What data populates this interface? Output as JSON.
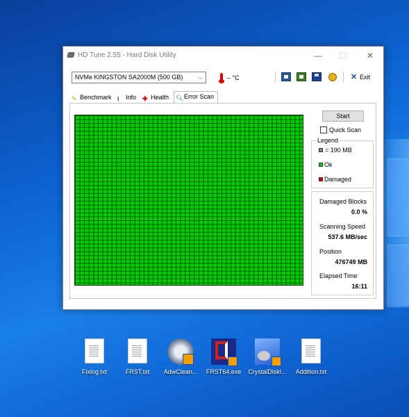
{
  "window": {
    "title": "HD Tune 2.55 - Hard Disk Utility",
    "minimize": "—",
    "maximize": "☐",
    "close": "✕"
  },
  "toolbar": {
    "drive": "NVMe    KINGSTON SA2000M (500 GB)",
    "temperature": "– °C",
    "exit_label": "Exit",
    "icons": [
      "copy-info-icon",
      "copy-screenshot-icon",
      "save-icon",
      "options-icon",
      "exit-icon"
    ]
  },
  "tabs": [
    {
      "label": "Benchmark",
      "icon": "benchmark-icon"
    },
    {
      "label": "Info",
      "icon": "info-icon"
    },
    {
      "label": "Health",
      "icon": "health-icon"
    },
    {
      "label": "Error Scan",
      "icon": "magnifier-icon",
      "active": true
    }
  ],
  "error_scan": {
    "start_label": "Start",
    "quick_scan_label": "Quick Scan",
    "quick_scan_checked": false,
    "legend": {
      "title": "Legend",
      "block_size": "= 190 MB",
      "ok": "Ok",
      "damaged": "Damaged"
    },
    "stats": {
      "damaged_blocks_label": "Damaged Blocks",
      "damaged_blocks_value": "0.0 %",
      "scanning_speed_label": "Scanning Speed",
      "scanning_speed_value": "537.6 MB/sec",
      "position_label": "Position",
      "position_value": "476749 MB",
      "elapsed_label": "Elapsed Time",
      "elapsed_value": "16:11"
    },
    "colors": {
      "ok": "#00cc00",
      "damaged": "#cc0000",
      "grid": "#005500"
    }
  },
  "desktop": {
    "icons": [
      {
        "label": "Fixlog.txt",
        "type": "text-file-icon"
      },
      {
        "label": "FRST.txt",
        "type": "text-file-icon"
      },
      {
        "label": "AdwClean...",
        "type": "adwcleaner-icon"
      },
      {
        "label": "FRST64.exe",
        "type": "frst-app-icon"
      },
      {
        "label": "CrystalDiskI...",
        "type": "crystaldiskinfo-icon"
      },
      {
        "label": "Addition.txt",
        "type": "text-file-icon"
      }
    ]
  }
}
